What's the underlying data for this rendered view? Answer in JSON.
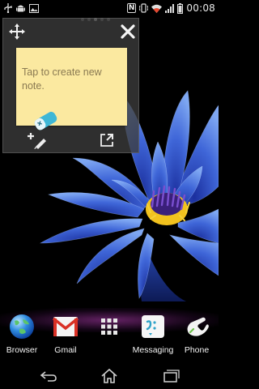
{
  "status_bar": {
    "time": "00:08",
    "nfc_label": "N",
    "icons": [
      "usb-icon",
      "android-icon",
      "image-icon",
      "nfc-icon",
      "vibrate-icon",
      "wifi-icon",
      "signal-icon",
      "battery-icon"
    ]
  },
  "notes_widget": {
    "note_text": "Tap to create new note.",
    "note_color": "#fbe9a0",
    "icons": [
      "move-icon",
      "close-icon",
      "eraser-icon",
      "add-note-icon",
      "open-external-icon"
    ]
  },
  "dock": {
    "items": [
      {
        "label": "Browser",
        "icon": "globe-icon"
      },
      {
        "label": "Gmail",
        "icon": "gmail-icon"
      },
      {
        "label": "",
        "icon": "app-drawer-icon"
      },
      {
        "label": "Messaging",
        "icon": "messaging-icon"
      },
      {
        "label": "Phone",
        "icon": "phone-icon"
      }
    ]
  },
  "nav_bar": {
    "buttons": [
      "back-icon",
      "home-icon",
      "recent-apps-icon"
    ]
  }
}
